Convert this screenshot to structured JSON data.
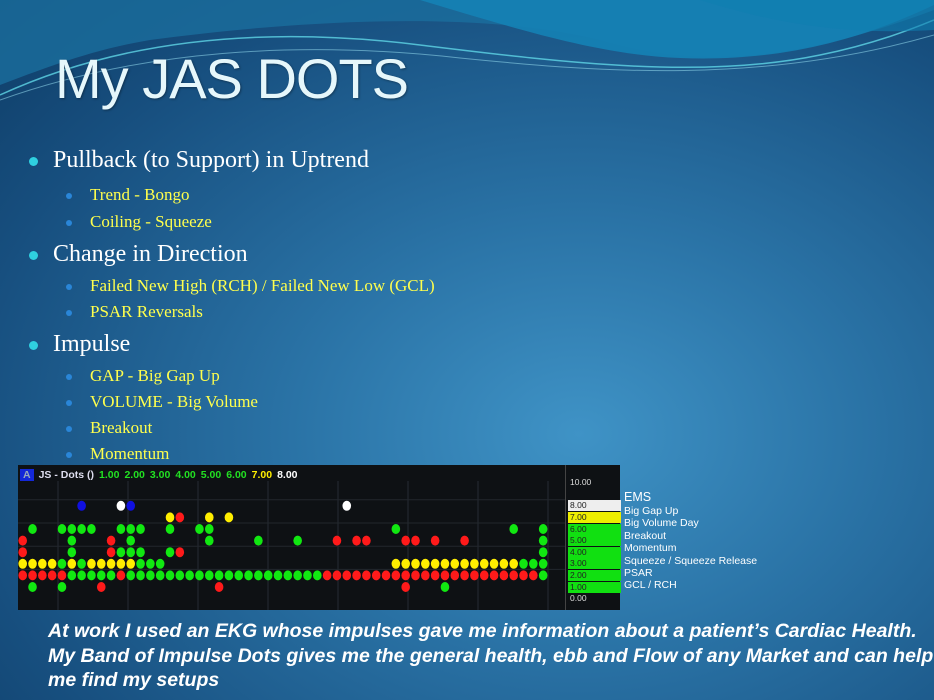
{
  "title": "My JAS DOTS",
  "bullets": [
    {
      "label": "Pullback (to Support) in Uptrend",
      "subs": [
        "Trend - Bongo",
        "Coiling - Squeeze"
      ]
    },
    {
      "label": "Change in Direction",
      "subs": [
        "Failed New High (RCH) / Failed New Low (GCL)",
        "PSAR Reversals"
      ]
    },
    {
      "label": "Impulse",
      "subs": [
        "GAP - Big Gap Up",
        "VOLUME - Big Volume",
        "Breakout",
        "Momentum"
      ]
    }
  ],
  "chart_data": {
    "type": "dot-matrix",
    "header": {
      "badge": "A",
      "name": "JS - Dots ()",
      "values": [
        "1.00",
        "2.00",
        "3.00",
        "4.00",
        "5.00",
        "6.00",
        "7.00",
        "8.00"
      ]
    },
    "y_ticks": [
      "10.00",
      "8.00",
      "7.00",
      "6.00",
      "5.00",
      "4.00",
      "3.00",
      "2.00",
      "1.00",
      "0.00"
    ],
    "ylim": [
      0,
      10
    ],
    "colors": {
      "G": "#11e811",
      "R": "#ff1a1a",
      "Y": "#ffee00",
      "B": "#1010e0",
      "W": "#ffffff"
    },
    "tag_colors": {
      "8.00": "#eeeeee",
      "7.00": "#eeee00",
      "6.00": "#11e011",
      "5.00": "#11e011",
      "4.00": "#11e011",
      "3.00": "#11e011",
      "2.00": "#11e011",
      "1.00": "#11e011"
    },
    "rows": [
      {
        "level": 8,
        "pattern": "......B...WB.....................W...................."
      },
      {
        "level": 7,
        "pattern": "...............YR..Y.Y................................"
      },
      {
        "level": 6,
        "pattern": ".G..GGGG..GGG..G..GG..................G...........G..G"
      },
      {
        "level": 5,
        "pattern": "R....G...R.G.......G....G...G...R.RR...RR.R..R.......G"
      },
      {
        "level": 4,
        "pattern": "R....G...RGGG..GR....................................G"
      },
      {
        "level": 3,
        "pattern": "YYYYGYGYYYYYGGG.......................YYYYYYYYYYYYYGGG"
      },
      {
        "level": 2,
        "pattern": "RRRRRGGGGGRGGGGGGGGGGGGGGGGGGGGRRRRRRRRRRRRRRRRRRRRRRG"
      },
      {
        "level": 1,
        "pattern": ".G..G...R...........R..................R...G.........."
      }
    ]
  },
  "legend": {
    "title": "EMS",
    "items": [
      "Big Gap Up",
      "Big Volume Day",
      "Breakout",
      "Momentum",
      "Squeeze / Squeeze Release",
      "PSAR",
      "GCL / RCH"
    ]
  },
  "caption": "At work I used an EKG whose impulses gave me information about a patient’s Cardiac Health.  My Band of Impulse Dots gives me the general health, ebb and Flow of any Market and can help me find my setups"
}
